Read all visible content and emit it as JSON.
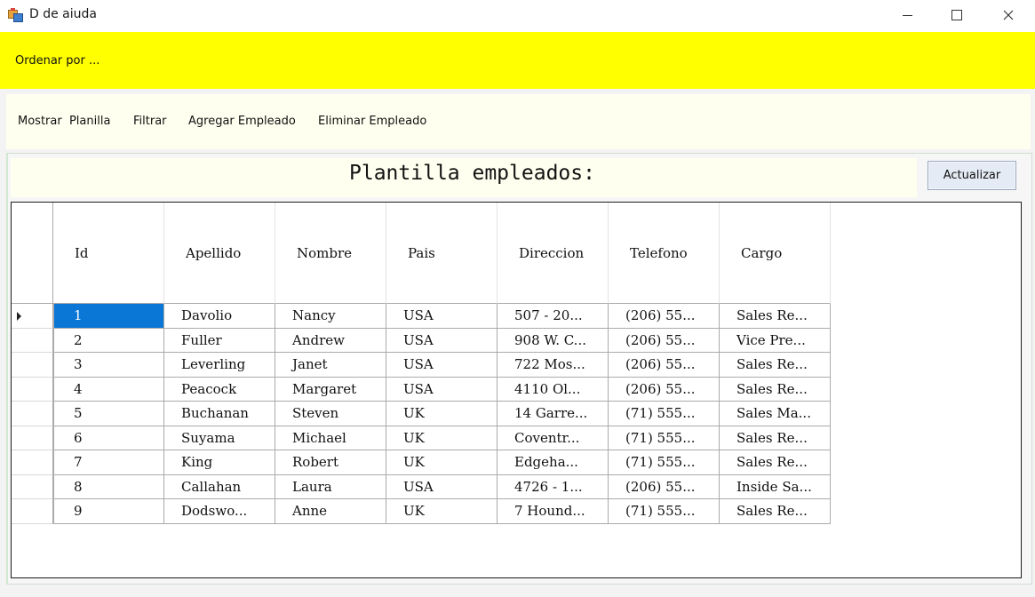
{
  "window": {
    "title": "D de aiuda"
  },
  "topbar": {
    "ordenar_label": "Ordenar por ..."
  },
  "menu": [
    "Mostrar  Planilla",
    "Filtrar",
    "Agregar Empleado",
    "Eliminar Empleado"
  ],
  "grid": {
    "title": "Plantilla empleados:",
    "refresh_label": "Actualizar",
    "columns": [
      "Id",
      "Apellido",
      "Nombre",
      "Pais",
      "Direccion",
      "Telefono",
      "Cargo"
    ],
    "rows": [
      [
        "1",
        "Davolio",
        "Nancy",
        "USA",
        "507 - 20...",
        "(206) 55...",
        "Sales Re..."
      ],
      [
        "2",
        "Fuller",
        "Andrew",
        "USA",
        "908 W. C...",
        "(206) 55...",
        "Vice Pre..."
      ],
      [
        "3",
        "Leverling",
        "Janet",
        "USA",
        "722 Mos...",
        "(206) 55...",
        "Sales Re..."
      ],
      [
        "4",
        "Peacock",
        "Margaret",
        "USA",
        "4110 Ol...",
        "(206) 55...",
        "Sales Re..."
      ],
      [
        "5",
        "Buchanan",
        "Steven",
        "UK",
        "14 Garre...",
        "(71) 555...",
        "Sales Ma..."
      ],
      [
        "6",
        "Suyama",
        "Michael",
        "UK",
        "Coventr...",
        "(71) 555...",
        "Sales Re..."
      ],
      [
        "7",
        "King",
        "Robert",
        "UK",
        "Edgeha...",
        "(71) 555...",
        "Sales Re..."
      ],
      [
        "8",
        "Callahan",
        "Laura",
        "USA",
        "4726 - 1...",
        "(206) 55...",
        "Inside Sa..."
      ],
      [
        "9",
        "Dodswo...",
        "Anne",
        "UK",
        "7 Hound...",
        "(71) 555...",
        "Sales Re..."
      ]
    ]
  },
  "colors": {
    "header_bar": "#ffff00",
    "panel_bg": "#fffff0",
    "selection": "#0a77d6"
  }
}
